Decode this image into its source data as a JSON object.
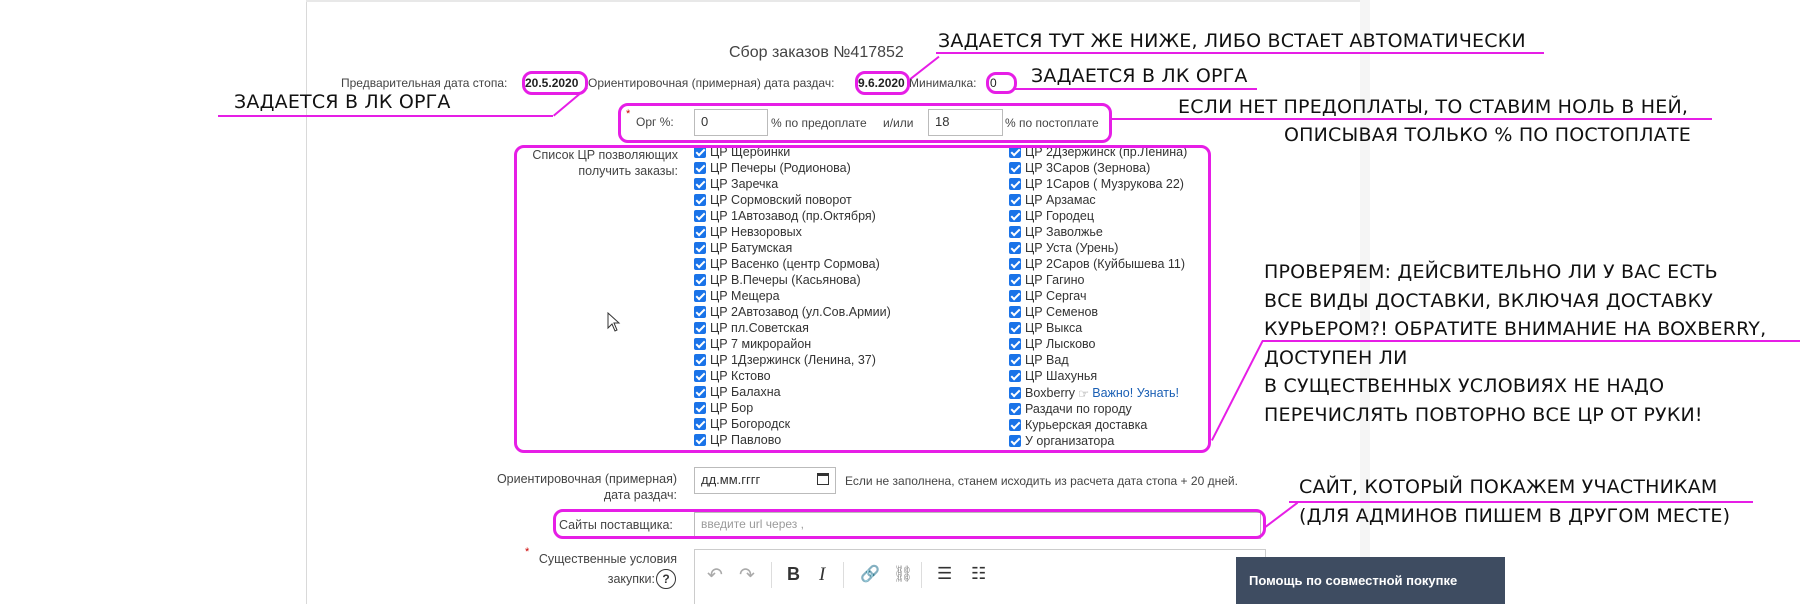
{
  "form": {
    "title": "Сбор заказов №417852",
    "stop_date_label": "Предварительная дата стопа:",
    "stop_date_value": "20.5.2020",
    "distribution_date_label": "Ориентировочная (примерная) дата раздач:",
    "distribution_date_value": "9.6.2020",
    "minimum_label": "Минималка:",
    "minimum_value": "0",
    "org_percent_label": "Орг %:",
    "org_prepay_value": "0",
    "org_prepay_suffix": "% по предоплате",
    "org_andor": "и/или",
    "org_postpay_value": "18",
    "org_postpay_suffix": "% по постоплате",
    "required_star": "*",
    "cr_list_label_line1": "Список ЦР позволяющих",
    "cr_list_label_line2": "получить заказы:",
    "cr_left": [
      "ЦР Щербинки",
      "ЦР Печеры (Родионова)",
      "ЦР Заречка",
      "ЦР Сормовский поворот",
      "ЦР 1Автозавод (пр.Октября)",
      "ЦР Невзоровых",
      "ЦР Батумская",
      "ЦР Васенко (центр Сормова)",
      "ЦР В.Печеры (Касьянова)",
      "ЦР Мещера",
      "ЦР 2Автозавод (ул.Сов.Армии)",
      "ЦР пл.Советская",
      "ЦР 7 микрорайон",
      "ЦР 1Дзержинск (Ленина, 37)",
      "ЦР Кстово",
      "ЦР Балахна",
      "ЦР Бор",
      "ЦР Богородск",
      "ЦР Павлово"
    ],
    "cr_right": [
      "ЦР 2Дзержинск (пр.Ленина)",
      "ЦР 3Саров (Зернова)",
      "ЦР 1Саров ( Музрукова 22)",
      "ЦР Арзамас",
      "ЦР Городец",
      "ЦР Заволжье",
      "ЦР Уста (Урень)",
      "ЦР 2Саров (Куйбышева 11)",
      "ЦР Гагино",
      "ЦР Сергач",
      "ЦР Семенов",
      "ЦР Выкса",
      "ЦР Лысково",
      "ЦР Вад",
      "ЦР Шахунья"
    ],
    "boxberry_label": "Boxberry",
    "boxberry_hand": "☞",
    "boxberry_link": "Важно! Узнать!",
    "city_distribution": "Раздачи по городу",
    "courier_delivery": "Курьерская доставка",
    "at_organizer": "У организатора",
    "approx_date_label_line1": "Ориентировочная (примерная)",
    "approx_date_label_line2": "дата раздач:",
    "approx_date_placeholder": "дд.мм.гггг",
    "approx_date_hint": "Если не заполнена, станем исходить из расчета дата стопа + 20 дней.",
    "supplier_sites_label": "Сайты поставщика:",
    "supplier_sites_placeholder": "введите url через ,",
    "essential_terms_line1": "Существенные условия",
    "essential_terms_line2": "закупки:",
    "help_q": "?"
  },
  "annotations": {
    "auto_date": "ЗАДАЕТСЯ ТУТ ЖЕ НИЖЕ, ЛИБО ВСТАЕТ АВТОМАТИЧЕСКИ",
    "lk_org_right": "ЗАДАЕТСЯ В ЛК ОРГА",
    "lk_org_left": "ЗАДАЕТСЯ В ЛК ОРГА",
    "prepay_line1": "ЕСЛИ НЕТ ПРЕДОПЛАТЫ, ТО СТАВИМ НОЛЬ В НЕЙ,",
    "prepay_line2": "ОПИСЫВАЯ ТОЛЬКО % ПО ПОСТОПЛАТЕ",
    "check_lines": [
      "ПРОВЕРЯЕМ: ДЕЙСВИТЕЛЬНО ЛИ У ВАС ЕСТЬ",
      "ВСЕ ВИДЫ ДОСТАВКИ, ВКЛЮЧАЯ ДОСТАВКУ",
      "КУРЬЕРОМ?! ОБРАТИТЕ ВНИМАНИЕ НА BOXBERRY,",
      "ДОСТУПЕН ЛИ",
      "В СУЩЕСТВЕННЫХ УСЛОВИЯХ НЕ НАДО",
      "ПЕРЕЧИСЛЯТЬ ПОВТОРНО ВСЕ ЦР ОТ РУКИ!"
    ],
    "site_line1": "САЙТ, КОТОРЫЙ ПОКАЖЕМ УЧАСТНИКАМ",
    "site_line2": "(ДЛЯ АДМИНОВ ПИШЕМ В ДРУГОМ МЕСТЕ)"
  },
  "editor_toolbar": {
    "undo": "↶",
    "redo": "↷",
    "bold": "B",
    "italic": "I",
    "link": "🔗",
    "unlink": "⛓",
    "bullets": "☰",
    "numbered": "☷"
  },
  "help_widget": {
    "label": "Помощь по совместной покупке"
  },
  "colors": {
    "annotation": "#e61ee6",
    "checkbox": "#1a73e8",
    "help_bg": "#3e4c61"
  }
}
